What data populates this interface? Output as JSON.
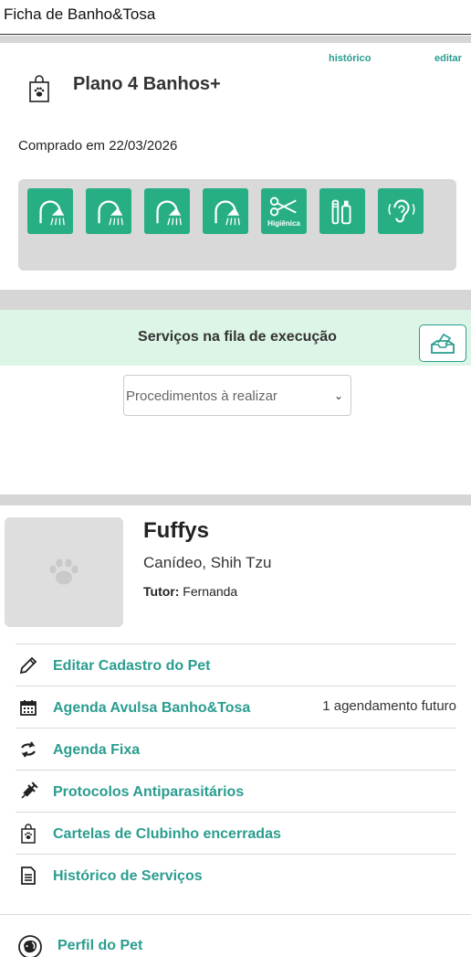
{
  "window": {
    "title": "Ficha de Banho&Tosa"
  },
  "plan": {
    "history_link": "histórico",
    "edit_link": "editar",
    "name": "Plano 4 Banhos+",
    "purchased": "Comprado em 22/03/2026",
    "bag_icon": "shopping-bag-paw-icon",
    "services": [
      {
        "icon": "shower-icon"
      },
      {
        "icon": "shower-icon"
      },
      {
        "icon": "shower-icon"
      },
      {
        "icon": "shower-icon"
      },
      {
        "icon": "scissors-icon",
        "label": "Higiênica"
      },
      {
        "icon": "toothbrush-icon"
      },
      {
        "icon": "ear-icon"
      }
    ],
    "tile_color": "#27ae84"
  },
  "queue": {
    "title": "Serviços na fila de execução",
    "button_icon": "tray-print-icon",
    "select_value": "Procedimentos à realizar"
  },
  "pet": {
    "name": "Fuffys",
    "breed": "Canídeo, Shih Tzu",
    "tutor_label": "Tutor:",
    "tutor_name": "Fernanda",
    "photo_icon": "paw-icon"
  },
  "menu": {
    "items": [
      {
        "icon": "pencil-icon",
        "label": "Editar Cadastro do Pet",
        "extra": ""
      },
      {
        "icon": "calendar-icon",
        "label": "Agenda Avulsa Banho&Tosa",
        "extra": "1 agendamento futuro"
      },
      {
        "icon": "recurring-arrows-icon",
        "label": "Agenda Fixa",
        "extra": ""
      },
      {
        "icon": "syringe-icon",
        "label": "Protocolos Antiparasitários",
        "extra": ""
      },
      {
        "icon": "shopping-bag-paw-icon",
        "label": "Cartelas de Clubinho encerradas",
        "extra": ""
      },
      {
        "icon": "document-icon",
        "label": "Histórico de Serviços",
        "extra": ""
      }
    ],
    "profile": {
      "icon": "dog-head-icon",
      "label": "Perfil do Pet"
    }
  },
  "colors": {
    "accent": "#2a9d8f",
    "queue_bg": "#dcf5e6",
    "separator": "#d6d6d6"
  }
}
